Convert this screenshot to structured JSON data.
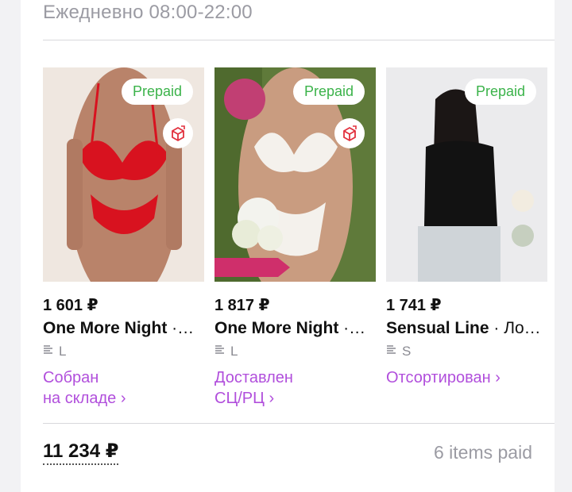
{
  "header": {
    "hours": "Ежедневно 08:00-22:00"
  },
  "products": [
    {
      "badge": "Prepaid",
      "price": "1 601 ₽",
      "brand": "One More Night",
      "name_suffix": " ·…",
      "size": "L",
      "status_line1": "Собран",
      "status_line2": "на складе ›",
      "photo_icon": "lingerie-red-photo"
    },
    {
      "badge": "Prepaid",
      "price": "1 817 ₽",
      "brand": "One More Night",
      "name_suffix": " ·…",
      "size": "L",
      "status_line1": "Доставлен",
      "status_line2": "СЦ/РЦ ›",
      "photo_icon": "lingerie-white-photo"
    },
    {
      "badge": "Prepaid",
      "price": "1 741 ₽",
      "brand": "Sensual Line",
      "name_suffix": " · Ло…",
      "size": "S",
      "status_line1": "Отсортирован ›",
      "status_line2": "",
      "photo_icon": "black-top-photo"
    }
  ],
  "summary": {
    "total": "11 234 ₽",
    "items_paid": "6 items paid"
  },
  "colors": {
    "accent_status": "#b14fdc",
    "prepaid_green": "#3bb34a"
  }
}
